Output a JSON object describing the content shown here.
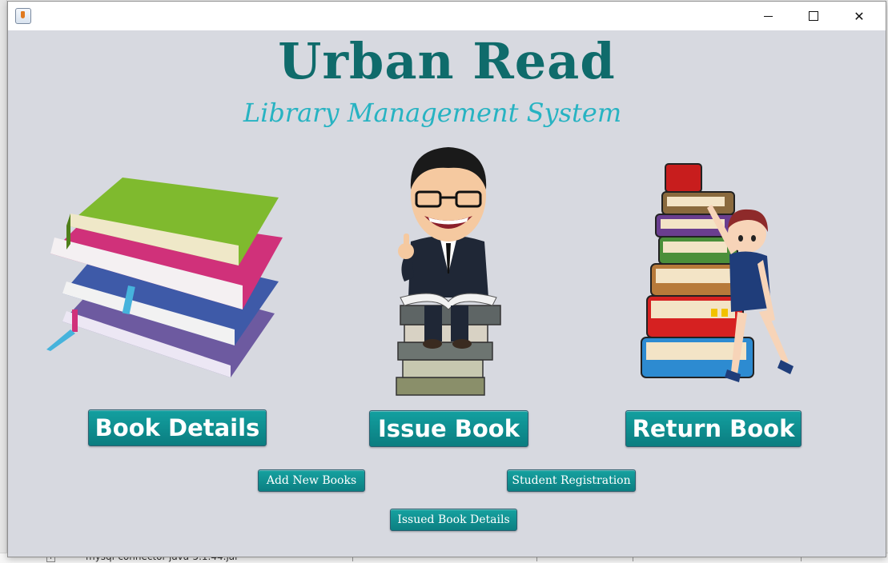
{
  "background": {
    "project_item": "mysql-connector-java-5.1.44.jar"
  },
  "window": {
    "controls": {
      "minimize": "minimize-icon",
      "maximize": "maximize-icon",
      "close": "close-icon"
    }
  },
  "header": {
    "title": "Urban Read",
    "subtitle": "Library Management System"
  },
  "main_buttons": {
    "book_details": "Book Details",
    "issue_book": "Issue Book",
    "return_book": "Return Book"
  },
  "secondary_buttons": {
    "add_new_books": "Add New Books",
    "student_registration": "Student Registration",
    "issued_book_details": "Issued Book Details"
  },
  "colors": {
    "title": "#0f6b6b",
    "subtitle": "#27b3c2",
    "button": "#0f8f91",
    "window_bg": "#d7d9e0"
  }
}
